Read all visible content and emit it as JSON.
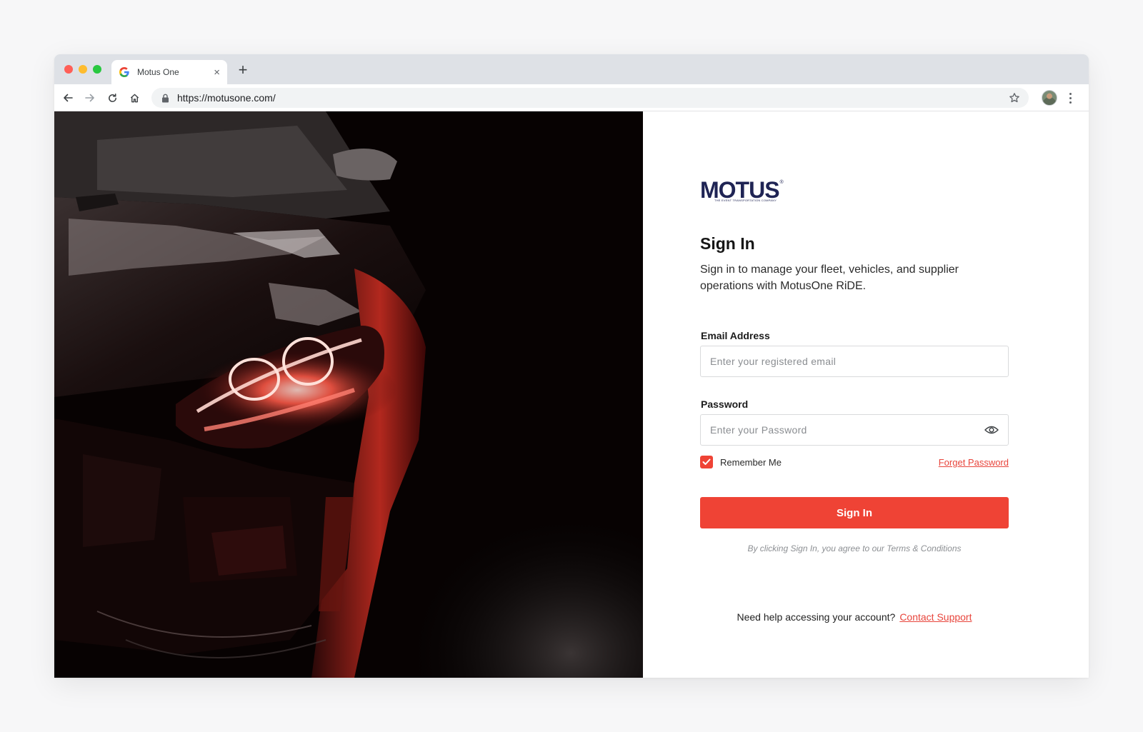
{
  "browser": {
    "tab_title": "Motus One",
    "url": "https://motusone.com/",
    "new_tab_label": "+",
    "close_tab_label": "×"
  },
  "brand": {
    "logo_text": "MOTUS",
    "logo_reg": "®",
    "tagline": "THE EVENT TRANSPORTATION COMPANY",
    "accent_color": "#ef4335",
    "navy_color": "#1f2454"
  },
  "form": {
    "title": "Sign In",
    "subtitle": "Sign in to manage your fleet, vehicles, and supplier operations with MotusOne RiDE.",
    "email_label": "Email Address",
    "email_placeholder": "Enter your registered email",
    "password_label": "Password",
    "password_placeholder": "Enter your Password",
    "remember_label": "Remember Me",
    "remember_checked": true,
    "forgot_label": "Forget Password",
    "submit_label": "Sign In",
    "terms_text": "By clicking Sign In, you agree to our Terms & Conditions"
  },
  "help": {
    "text": "Need help accessing your account?",
    "link_label": "Contact Support"
  },
  "icons": {
    "back": "arrow-left-icon",
    "forward": "arrow-right-icon",
    "reload": "reload-icon",
    "home": "home-icon",
    "lock": "lock-icon",
    "bookmark": "star-icon",
    "menu": "kebab-menu-icon",
    "show_password": "eye-icon",
    "checkbox": "check-icon"
  }
}
